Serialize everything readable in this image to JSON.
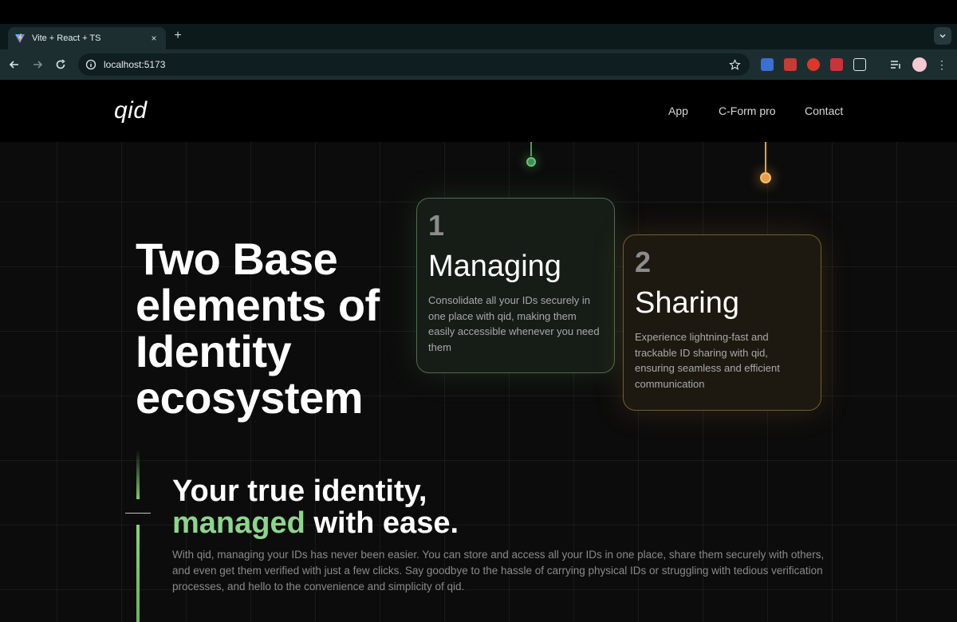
{
  "browser": {
    "tab_title": "Vite + React + TS",
    "tab_close": "×",
    "new_tab": "+",
    "url": "localhost:5173"
  },
  "site": {
    "logo": "qid",
    "nav": [
      "App",
      "C-Form pro",
      "Contact"
    ]
  },
  "hero": {
    "headline": "Two Base elements of Identity ecosystem",
    "cards": [
      {
        "number": "1",
        "title": "Managing",
        "description": "Consolidate all your IDs securely in one place with qid, making them easily accessible whenever you need them"
      },
      {
        "number": "2",
        "title": "Sharing",
        "description": "Experience lightning-fast and trackable ID sharing with qid, ensuring seamless and efficient communication"
      }
    ]
  },
  "intro": {
    "line1": "Your true identity,",
    "accent": "managed",
    "line2_rest": " with ease.",
    "paragraph": "With qid, managing your IDs has never been easier. You can store and access all your IDs in one place, share them securely with others, and even get them verified with just a few clicks. Say goodbye to the hassle of carrying physical IDs or struggling with tedious verification processes, and hello to the convenience and simplicity of qid."
  },
  "colors": {
    "accent_green": "#8fd48e",
    "accent_orange": "#e7a04a",
    "card_green_border": "#4f6b50",
    "card_orange_border": "#6f5d35"
  },
  "icons": [
    "vite-favicon",
    "back-arrow-icon",
    "forward-arrow-icon",
    "reload-icon",
    "site-info-icon",
    "bookmark-star-icon",
    "extension-icon",
    "profile-avatar",
    "more-menu-icon",
    "tab-list-chevron-icon"
  ]
}
